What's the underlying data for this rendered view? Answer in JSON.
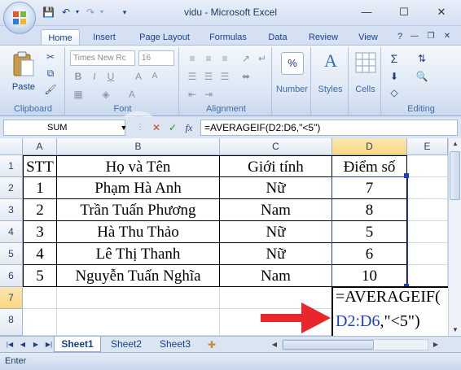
{
  "window": {
    "title": "vidu - Microsoft Excel",
    "minimize": "—",
    "maximize": "☐",
    "close": "✕"
  },
  "quick_access": {
    "save": "save-icon",
    "undo": "undo-icon",
    "redo": "redo-icon"
  },
  "tabs": [
    "Home",
    "Insert",
    "Page Layout",
    "Formulas",
    "Data",
    "Review",
    "View"
  ],
  "ribbon": {
    "clipboard": {
      "label": "Clipboard",
      "paste": "Paste"
    },
    "font": {
      "label": "Font",
      "font_name": "Times New Rc",
      "font_size": "16"
    },
    "alignment": {
      "label": "Alignment"
    },
    "number": {
      "label": "Number",
      "symbol": "%"
    },
    "styles": {
      "label": "Styles"
    },
    "cells": {
      "label": "Cells"
    },
    "editing": {
      "label": "Editing"
    }
  },
  "formula_bar": {
    "name_box": "SUM",
    "fx": "fx",
    "formula": "=AVERAGEIF(D2:D6,\"<5\")"
  },
  "columns": [
    "A",
    "B",
    "C",
    "D",
    "E"
  ],
  "rows": [
    "1",
    "2",
    "3",
    "4",
    "5",
    "6",
    "7",
    "8"
  ],
  "table": {
    "headers": [
      "STT",
      "Họ và Tên",
      "Giới tính",
      "Điểm số"
    ],
    "rows": [
      [
        "1",
        "Phạm Hà Anh",
        "Nữ",
        "7"
      ],
      [
        "2",
        "Trần Tuấn Phương",
        "Nam",
        "8"
      ],
      [
        "3",
        "Hà Thu Thảo",
        "Nữ",
        "5"
      ],
      [
        "4",
        "Lê Thị Thanh",
        "Nữ",
        "6"
      ],
      [
        "5",
        "Nguyễn Tuấn Nghĩa",
        "Nam",
        "10"
      ]
    ]
  },
  "editing_cell": {
    "line1": "=AVERAGEIF(",
    "line2_range": "D2:D6",
    "line2_rest": ",\"<5\")"
  },
  "sheets": [
    "Sheet1",
    "Sheet2",
    "Sheet3"
  ],
  "status": "Enter",
  "colors": {
    "arrow": "#e8262b",
    "range_blue": "#1f3fbf",
    "active_border": "#1f3fbf"
  }
}
